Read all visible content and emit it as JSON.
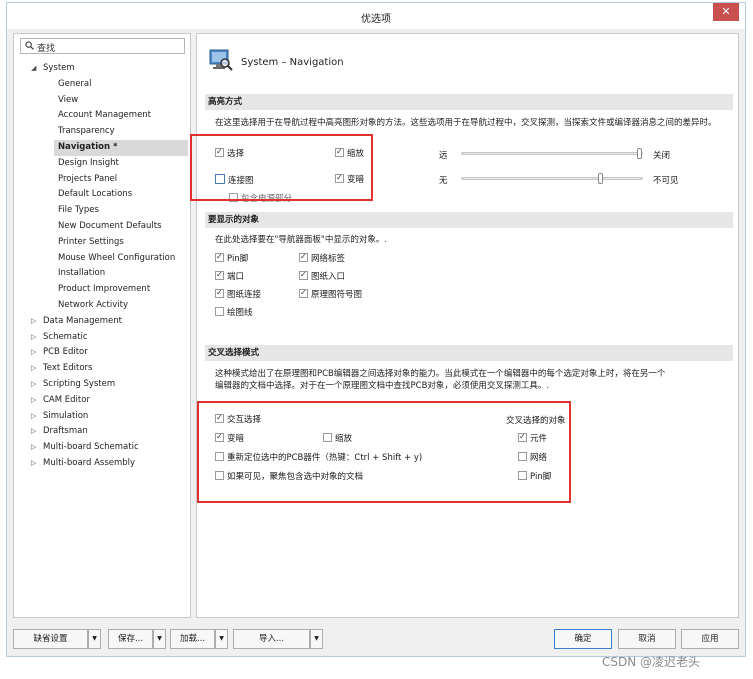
{
  "window": {
    "title": "优选项",
    "close": "✕"
  },
  "search": {
    "placeholder": "查找"
  },
  "tree": {
    "root": "System",
    "children": [
      "General",
      "View",
      "Account Management",
      "Transparency",
      "Navigation *",
      "Design Insight",
      "Projects Panel",
      "Default Locations",
      "File Types",
      "New Document Defaults",
      "Printer Settings",
      "Mouse Wheel Configuration",
      "Installation",
      "Product Improvement",
      "Network Activity"
    ],
    "others": [
      "Data Management",
      "Schematic",
      "PCB Editor",
      "Text Editors",
      "Scripting System",
      "CAM Editor",
      "Simulation",
      "Draftsman",
      "Multi-board Schematic",
      "Multi-board Assembly"
    ]
  },
  "page": {
    "title": "System – Navigation"
  },
  "highlight": {
    "header": "高亮方式",
    "desc": "在这里选择用于在导航过程中高亮图形对象的方法。这些选项用于在导航过程中，交叉探测，当探索文件或编译器消息之间的差异时。",
    "select": "选择",
    "zoom": "缩放",
    "connect": "连接图",
    "dim": "变暗",
    "include_power": "包含电源部分",
    "far": "远",
    "off": "关闭",
    "none": "无",
    "opaque": "不可见",
    "slider1_level": 1.0,
    "slider2_level": 0.78
  },
  "objects": {
    "header": "要显示的对象",
    "desc": "在此处选择要在\"导航器面板\"中显示的对象。.",
    "pin": "Pin脚",
    "net_label": "网络标签",
    "port": "端口",
    "sheet_entry": "图纸入口",
    "sheet_connector": "图纸连接",
    "sheet_symbol": "原理图符号图",
    "wire": "绘图线"
  },
  "cross": {
    "header": "交叉选择模式",
    "desc1": "这种模式给出了在原理图和PCB编辑器之间选择对象的能力。当此模式在一个编辑器中的每个选定对象上时，将在另一个",
    "desc2": "编辑器的文档中选择。对于在一个原理图文档中查找PCB对象，必须使用交叉探测工具。.",
    "cross_select": "交互选择",
    "dim": "变暗",
    "zoom": "缩放",
    "reposition": "重新定位选中的PCB器件（热键：Ctrl + Shift + y)",
    "focus": "如果可见，聚焦包含选中对象的文档",
    "objects_title": "交叉选择的对象",
    "component": "元件",
    "net": "网络",
    "pin": "Pin脚"
  },
  "footer": {
    "defaults": "缺省设置",
    "save": "保存...",
    "load": "加载...",
    "import": "导入...",
    "ok": "确定",
    "cancel": "取消",
    "apply": "应用"
  },
  "watermark": "CSDN @凌迟老头"
}
